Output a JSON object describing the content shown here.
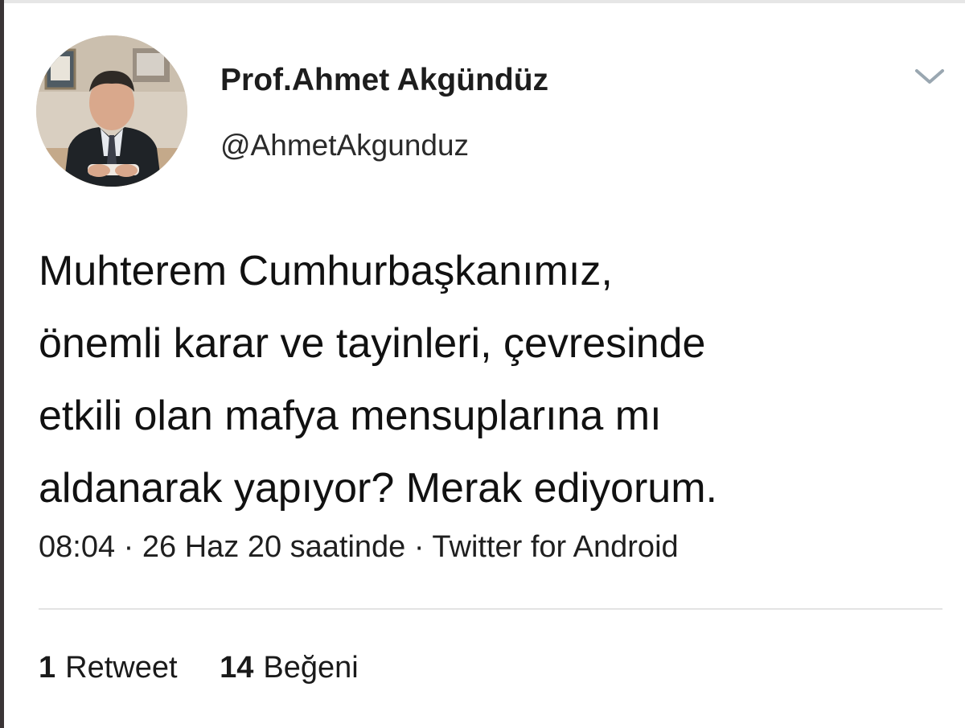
{
  "tweet": {
    "author": {
      "display_name": "Prof.Ahmet Akgündüz",
      "handle": "@AhmetAkgunduz"
    },
    "menu_icon": "chevron-down-icon",
    "text_lines": [
      "Muhterem Cumhurbaşkanımız,",
      "önemli karar ve tayinleri, çevresinde",
      "etkili olan mafya mensuplarına mı",
      "aldanarak yapıyor? Merak ediyorum."
    ],
    "meta": "08:04 · 26 Haz 20 saatinde · Twitter for Android",
    "stats": {
      "retweets": {
        "count": "1",
        "label": "Retweet"
      },
      "likes": {
        "count": "14",
        "label": "Beğeni"
      }
    }
  },
  "colors": {
    "text": "#111111",
    "divider": "#e3e3e3",
    "chevron": "#9aa7b1"
  }
}
